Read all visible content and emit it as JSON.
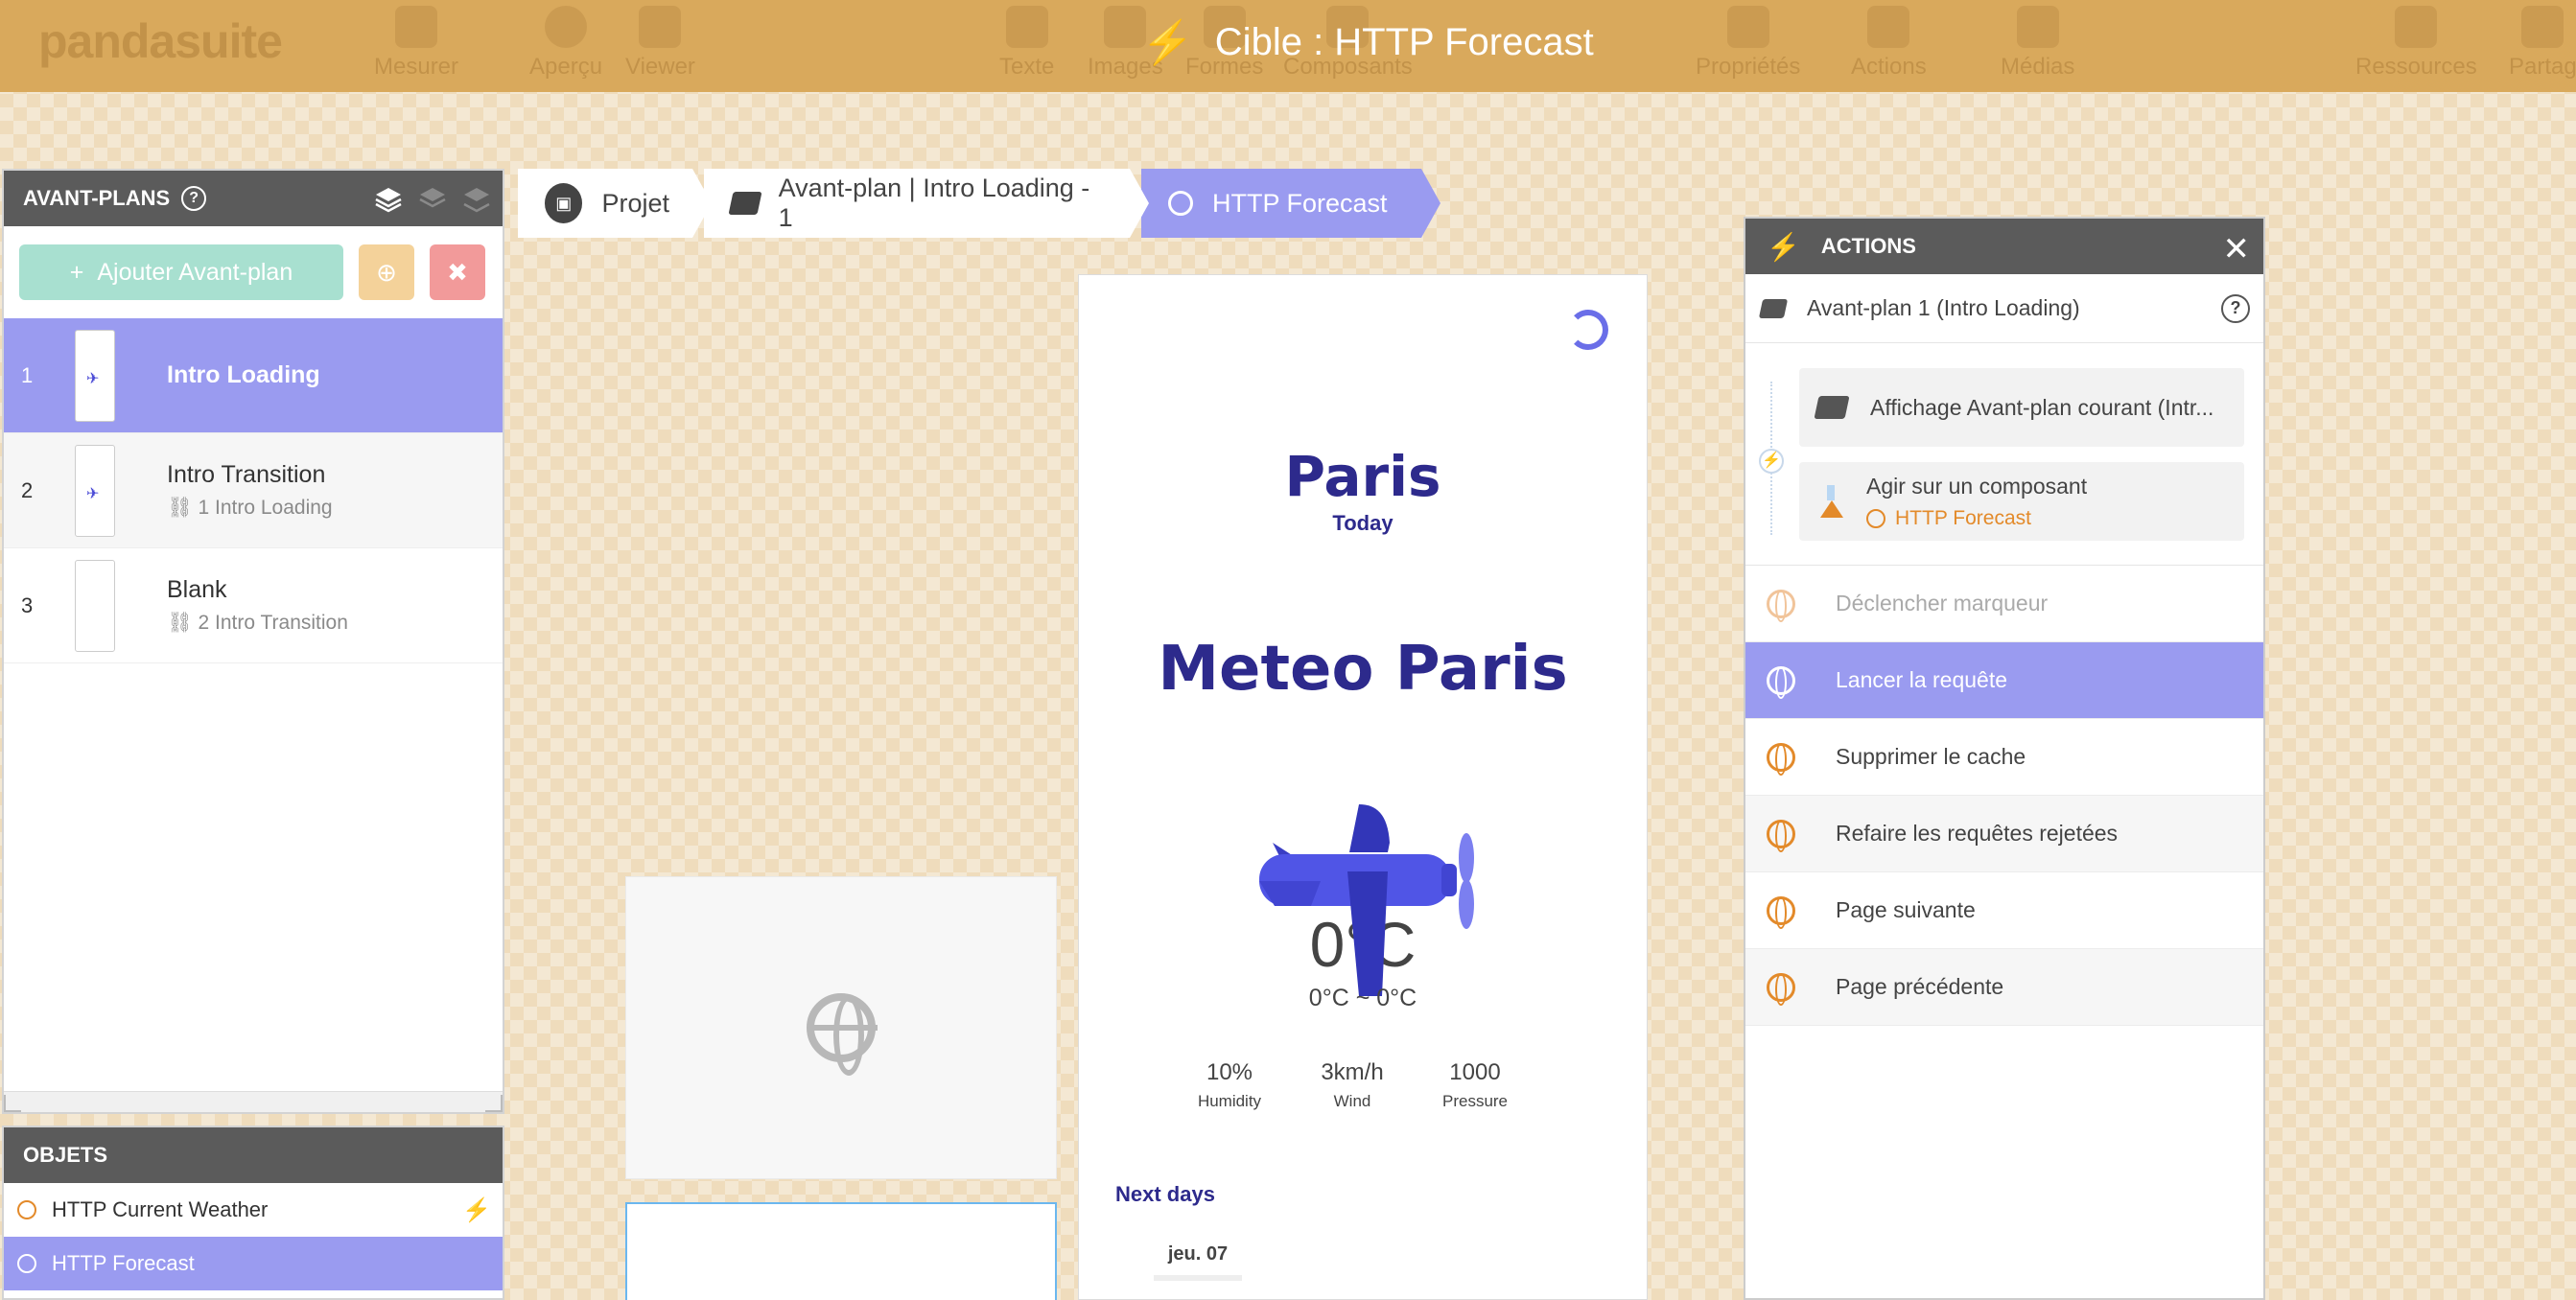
{
  "topbar": {
    "logo": "pandasuite",
    "buttons_left": [
      "Mesurer",
      "Aperçu",
      "Viewer"
    ],
    "buttons_mid": [
      "Texte",
      "Images",
      "Formes",
      "Composants"
    ],
    "title": "Cible : HTTP Forecast",
    "buttons_right": [
      "Propriétés",
      "Actions",
      "Médias"
    ],
    "buttons_far": [
      "Ressources",
      "Partag"
    ]
  },
  "avantplans": {
    "title": "AVANT-PLANS",
    "add_label": "Ajouter Avant-plan",
    "items": [
      {
        "num": "1",
        "name": "Intro Loading",
        "sub": ""
      },
      {
        "num": "2",
        "name": "Intro Transition",
        "sub": "1  Intro Loading"
      },
      {
        "num": "3",
        "name": "Blank",
        "sub": "2  Intro Transition"
      }
    ]
  },
  "objets": {
    "title": "OBJETS",
    "items": [
      "HTTP Current Weather",
      "HTTP Forecast"
    ]
  },
  "breadcrumb": [
    "Projet",
    "Avant-plan | Intro Loading - 1",
    "HTTP Forecast"
  ],
  "preview": {
    "city": "Paris",
    "today": "Today",
    "headline": "Meteo Paris",
    "temp": "0°C",
    "temp_range": "0°C ~ 0°C",
    "stats": [
      {
        "value": "10%",
        "label": "Humidity"
      },
      {
        "value": "3km/h",
        "label": "Wind"
      },
      {
        "value": "1000",
        "label": "Pressure"
      }
    ],
    "next_days": "Next days",
    "day": "jeu. 07"
  },
  "actions": {
    "title": "ACTIONS",
    "context": "Avant-plan 1 (Intro Loading)",
    "trigger_a": "Affichage Avant-plan courant (Intr...",
    "trigger_b": "Agir sur un composant",
    "trigger_b_target": "HTTP Forecast",
    "list": [
      "Déclencher marqueur",
      "Lancer la requête",
      "Supprimer le cache",
      "Refaire les requêtes rejetées",
      "Page suivante",
      "Page précédente"
    ]
  },
  "colors": {
    "topbar": "#d9a95c",
    "accent": "#9a9bf0",
    "navy": "#2d2a8c",
    "orange": "#e38a2a"
  }
}
